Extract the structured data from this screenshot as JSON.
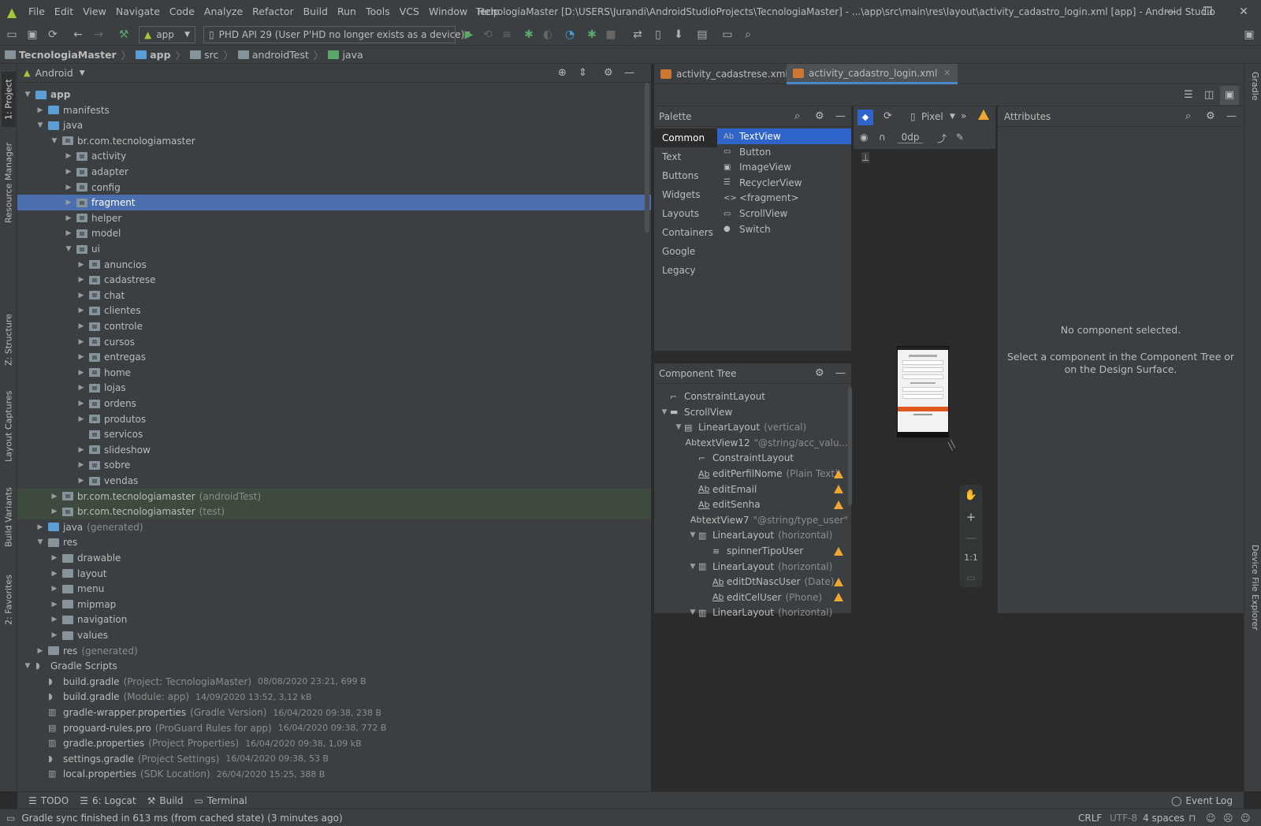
{
  "menu": {
    "items": [
      "File",
      "Edit",
      "View",
      "Navigate",
      "Code",
      "Analyze",
      "Refactor",
      "Build",
      "Run",
      "Tools",
      "VCS",
      "Window",
      "Help"
    ],
    "window_title": "TecnologiaMaster [D:\\USERS\\Jurandi\\AndroidStudioProjects\\TecnologiaMaster] - ...\\app\\src\\main\\res\\layout\\activity_cadastro_login.xml [app] - Android Studio"
  },
  "toolbar": {
    "run_config": "app",
    "device": "PHD API 29 (User P'HD no longer exists as a device)"
  },
  "breadcrumbs": [
    "TecnologiaMaster",
    "app",
    "src",
    "androidTest",
    "java"
  ],
  "side_tabs": {
    "left": [
      "1: Project",
      "Resource Manager",
      "Z: Structure",
      "Layout Captures",
      "Build Variants",
      "2: Favorites"
    ],
    "right": [
      "Gradle",
      "Device File Explorer"
    ]
  },
  "project": {
    "view_mode": "Android",
    "tree": [
      {
        "label": "app",
        "depth": 0,
        "expanded": true,
        "icon": "module",
        "selected": false
      },
      {
        "label": "manifests",
        "depth": 1,
        "expanded": false,
        "icon": "folder-blue"
      },
      {
        "label": "java",
        "depth": 1,
        "expanded": true,
        "icon": "folder-blue"
      },
      {
        "label": "br.com.tecnologiamaster",
        "depth": 2,
        "expanded": true,
        "icon": "package"
      },
      {
        "label": "activity",
        "depth": 3,
        "expanded": false,
        "icon": "package"
      },
      {
        "label": "adapter",
        "depth": 3,
        "expanded": false,
        "icon": "package"
      },
      {
        "label": "config",
        "depth": 3,
        "expanded": false,
        "icon": "package"
      },
      {
        "label": "fragment",
        "depth": 3,
        "expanded": false,
        "icon": "package",
        "selected": true
      },
      {
        "label": "helper",
        "depth": 3,
        "expanded": false,
        "icon": "package"
      },
      {
        "label": "model",
        "depth": 3,
        "expanded": false,
        "icon": "package"
      },
      {
        "label": "ui",
        "depth": 3,
        "expanded": true,
        "icon": "package"
      },
      {
        "label": "anuncios",
        "depth": 4,
        "expanded": false,
        "icon": "package"
      },
      {
        "label": "cadastrese",
        "depth": 4,
        "expanded": false,
        "icon": "package"
      },
      {
        "label": "chat",
        "depth": 4,
        "expanded": false,
        "icon": "package"
      },
      {
        "label": "clientes",
        "depth": 4,
        "expanded": false,
        "icon": "package"
      },
      {
        "label": "controle",
        "depth": 4,
        "expanded": false,
        "icon": "package"
      },
      {
        "label": "cursos",
        "depth": 4,
        "expanded": false,
        "icon": "package"
      },
      {
        "label": "entregas",
        "depth": 4,
        "expanded": false,
        "icon": "package"
      },
      {
        "label": "home",
        "depth": 4,
        "expanded": false,
        "icon": "package"
      },
      {
        "label": "lojas",
        "depth": 4,
        "expanded": false,
        "icon": "package"
      },
      {
        "label": "ordens",
        "depth": 4,
        "expanded": false,
        "icon": "package"
      },
      {
        "label": "produtos",
        "depth": 4,
        "expanded": false,
        "icon": "package"
      },
      {
        "label": "servicos",
        "depth": 4,
        "leaf": true,
        "icon": "package"
      },
      {
        "label": "slideshow",
        "depth": 4,
        "expanded": false,
        "icon": "package"
      },
      {
        "label": "sobre",
        "depth": 4,
        "expanded": false,
        "icon": "package"
      },
      {
        "label": "vendas",
        "depth": 4,
        "expanded": false,
        "icon": "package"
      },
      {
        "label": "br.com.tecnologiamaster",
        "hint": "(androidTest)",
        "depth": 2,
        "expanded": false,
        "icon": "package",
        "test": true
      },
      {
        "label": "br.com.tecnologiamaster",
        "hint": "(test)",
        "depth": 2,
        "expanded": false,
        "icon": "package",
        "test": true
      },
      {
        "label": "java",
        "hint": "(generated)",
        "depth": 1,
        "expanded": false,
        "icon": "folder-blue"
      },
      {
        "label": "res",
        "depth": 1,
        "expanded": true,
        "icon": "folder-gray"
      },
      {
        "label": "drawable",
        "depth": 2,
        "expanded": false,
        "icon": "folder-gray"
      },
      {
        "label": "layout",
        "depth": 2,
        "expanded": false,
        "icon": "folder-gray"
      },
      {
        "label": "menu",
        "depth": 2,
        "expanded": false,
        "icon": "folder-gray"
      },
      {
        "label": "mipmap",
        "depth": 2,
        "expanded": false,
        "icon": "folder-gray"
      },
      {
        "label": "navigation",
        "depth": 2,
        "expanded": false,
        "icon": "folder-gray"
      },
      {
        "label": "values",
        "depth": 2,
        "expanded": false,
        "icon": "folder-gray"
      },
      {
        "label": "res",
        "hint": "(generated)",
        "depth": 1,
        "expanded": false,
        "icon": "folder-gray"
      },
      {
        "label": "Gradle Scripts",
        "depth": 0,
        "expanded": true,
        "icon": "gradle"
      },
      {
        "label": "build.gradle",
        "hint": "(Project: TecnologiaMaster)",
        "meta": "08/08/2020 23:21, 699 B",
        "depth": 1,
        "leaf": true,
        "icon": "gradle"
      },
      {
        "label": "build.gradle",
        "hint": "(Module: app)",
        "meta": "14/09/2020 13:52, 3,12 kB",
        "depth": 1,
        "leaf": true,
        "icon": "gradle"
      },
      {
        "label": "gradle-wrapper.properties",
        "hint": "(Gradle Version)",
        "meta": "16/04/2020 09:38, 238 B",
        "depth": 1,
        "leaf": true,
        "icon": "props"
      },
      {
        "label": "proguard-rules.pro",
        "hint": "(ProGuard Rules for app)",
        "meta": "16/04/2020 09:38, 772 B",
        "depth": 1,
        "leaf": true,
        "icon": "file"
      },
      {
        "label": "gradle.properties",
        "hint": "(Project Properties)",
        "meta": "16/04/2020 09:38, 1,09 kB",
        "depth": 1,
        "leaf": true,
        "icon": "props"
      },
      {
        "label": "settings.gradle",
        "hint": "(Project Settings)",
        "meta": "16/04/2020 09:38, 53 B",
        "depth": 1,
        "leaf": true,
        "icon": "gradle"
      },
      {
        "label": "local.properties",
        "hint": "(SDK Location)",
        "meta": "26/04/2020 15:25, 388 B",
        "depth": 1,
        "leaf": true,
        "icon": "props"
      }
    ]
  },
  "editor_tabs": [
    {
      "label": "activity_cadastrese.xml",
      "active": false
    },
    {
      "label": "activity_cadastro_login.xml",
      "active": true
    }
  ],
  "palette": {
    "title": "Palette",
    "categories": [
      "Common",
      "Text",
      "Buttons",
      "Widgets",
      "Layouts",
      "Containers",
      "Google",
      "Legacy"
    ],
    "items": [
      {
        "icon": "Ab",
        "label": "TextView"
      },
      {
        "icon": "▭",
        "label": "Button"
      },
      {
        "icon": "▣",
        "label": "ImageView"
      },
      {
        "icon": "☰",
        "label": "RecyclerView"
      },
      {
        "icon": "<>",
        "label": "<fragment>"
      },
      {
        "icon": "▭",
        "label": "ScrollView"
      },
      {
        "icon": "●",
        "label": "Switch"
      }
    ]
  },
  "design_toolbar": {
    "device": "Pixel",
    "margin": "0dp"
  },
  "component_tree": {
    "title": "Component Tree",
    "rows": [
      {
        "label": "ConstraintLayout",
        "depth": 0,
        "icon": "constraint",
        "arrow": ""
      },
      {
        "label": "ScrollView",
        "depth": 0,
        "icon": "scroll",
        "arrow": "▼"
      },
      {
        "label": "LinearLayout",
        "hint": "(vertical)",
        "depth": 1,
        "icon": "linear",
        "arrow": "▼"
      },
      {
        "label": "textView12",
        "hint": "\"@string/acc_valu...",
        "depth": 2,
        "icon": "Ab"
      },
      {
        "label": "ConstraintLayout",
        "depth": 2,
        "icon": "constraint"
      },
      {
        "label": "editPerfilNome",
        "hint": "(Plain Text)",
        "depth": 2,
        "icon": "edit",
        "warn": true
      },
      {
        "label": "editEmail",
        "depth": 2,
        "icon": "edit",
        "warn": true
      },
      {
        "label": "editSenha",
        "depth": 2,
        "icon": "edit",
        "warn": true
      },
      {
        "label": "textView7",
        "hint": "\"@string/type_user\"",
        "depth": 2,
        "icon": "Ab"
      },
      {
        "label": "LinearLayout",
        "hint": "(horizontal)",
        "depth": 2,
        "icon": "linearh",
        "arrow": "▼"
      },
      {
        "label": "spinnerTipoUser",
        "depth": 3,
        "icon": "spinner",
        "warn": true
      },
      {
        "label": "LinearLayout",
        "hint": "(horizontal)",
        "depth": 2,
        "icon": "linearh",
        "arrow": "▼"
      },
      {
        "label": "editDtNascUser",
        "hint": "(Date)",
        "depth": 3,
        "icon": "edit",
        "warn": true
      },
      {
        "label": "editCelUser",
        "hint": "(Phone)",
        "depth": 3,
        "icon": "edit",
        "warn": true
      },
      {
        "label": "LinearLayout",
        "hint": "(horizontal)",
        "depth": 2,
        "icon": "linearh",
        "arrow": "▼"
      }
    ]
  },
  "zoom": {
    "reset_label": "1:1"
  },
  "attributes": {
    "title": "Attributes",
    "empty_title": "No component selected.",
    "empty_body_1": "Select a component in the Component Tree or",
    "empty_body_2": "on the Design Surface."
  },
  "bottom_tabs": [
    {
      "label": "TODO",
      "icon": "☰"
    },
    {
      "label": "6: Logcat",
      "icon": "☰"
    },
    {
      "label": "Build",
      "icon": "⚒"
    },
    {
      "label": "Terminal",
      "icon": "▭"
    }
  ],
  "event_log": "Event Log",
  "status": {
    "message": "Gradle sync finished in 613 ms (from cached state) (3 minutes ago)",
    "line_sep": "CRLF",
    "encoding": "UTF-8",
    "indent": "4 spaces"
  }
}
